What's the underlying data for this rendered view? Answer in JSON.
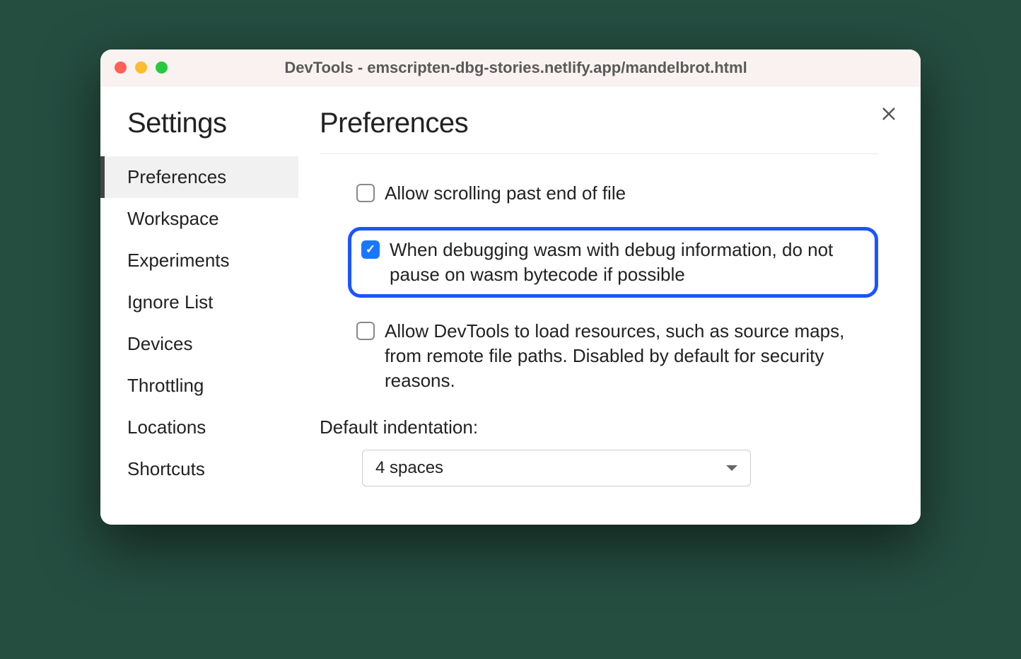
{
  "window": {
    "title": "DevTools - emscripten-dbg-stories.netlify.app/mandelbrot.html"
  },
  "sidebar": {
    "title": "Settings",
    "items": [
      {
        "label": "Preferences",
        "active": true
      },
      {
        "label": "Workspace",
        "active": false
      },
      {
        "label": "Experiments",
        "active": false
      },
      {
        "label": "Ignore List",
        "active": false
      },
      {
        "label": "Devices",
        "active": false
      },
      {
        "label": "Throttling",
        "active": false
      },
      {
        "label": "Locations",
        "active": false
      },
      {
        "label": "Shortcuts",
        "active": false
      }
    ]
  },
  "main": {
    "title": "Preferences",
    "options": [
      {
        "label": "Allow scrolling past end of file",
        "checked": false,
        "highlighted": false
      },
      {
        "label": "When debugging wasm with debug information, do not pause on wasm bytecode if possible",
        "checked": true,
        "highlighted": true
      },
      {
        "label": "Allow DevTools to load resources, such as source maps, from remote file paths. Disabled by default for security reasons.",
        "checked": false,
        "highlighted": false
      }
    ],
    "indentation": {
      "label": "Default indentation:",
      "value": "4 spaces"
    }
  }
}
